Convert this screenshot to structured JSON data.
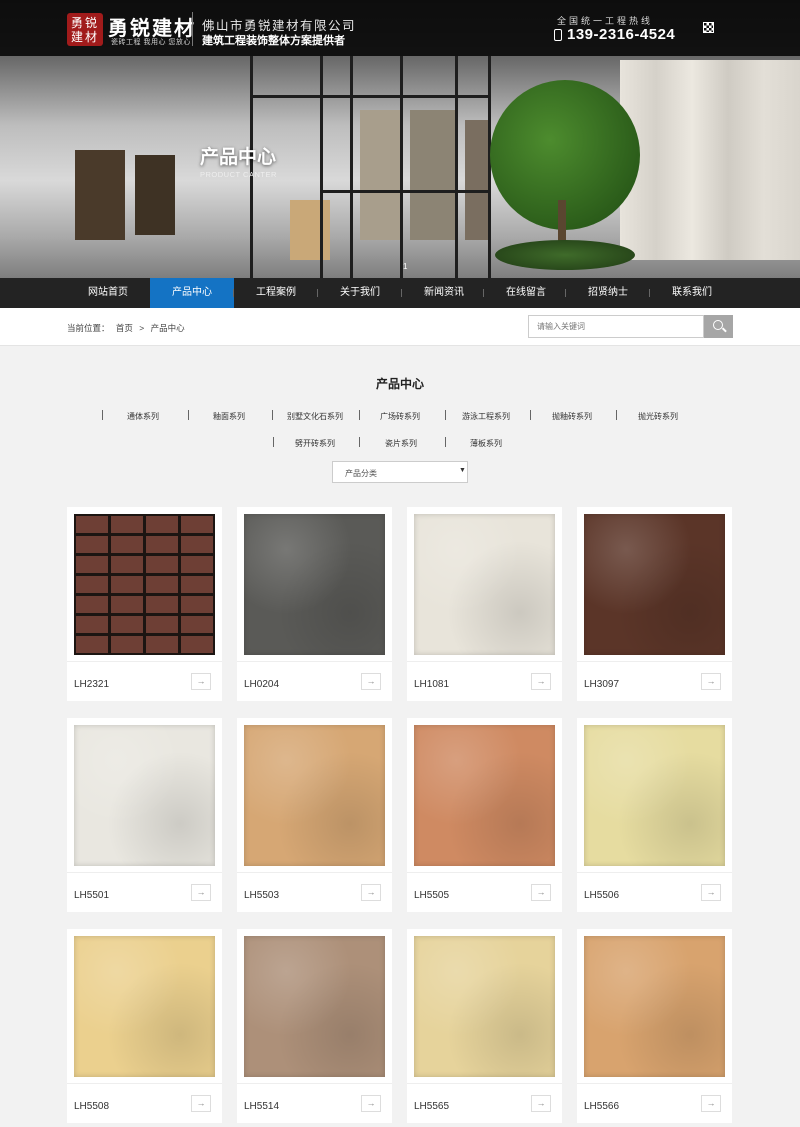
{
  "header": {
    "logo_seal": "勇锐建材",
    "logo_name": "勇锐建材",
    "logo_slogan": "瓷砖工程 我用心 您放心",
    "company_name": "佛山市勇锐建材有限公司",
    "tagline": "建筑工程装饰整体方案提供者",
    "hotline_label": "全国统一工程热线",
    "hotline_number": "139-2316-4524"
  },
  "banner": {
    "title": "产品中心",
    "subtitle": "PRODUCT CANTER",
    "slide_number": "1"
  },
  "nav": {
    "items": [
      "网站首页",
      "产品中心",
      "工程案例",
      "关于我们",
      "新闻资讯",
      "在线留言",
      "招贤纳士",
      "联系我们"
    ],
    "active_index": 1
  },
  "breadcrumb": {
    "label": "当前位置：",
    "home": "首页",
    "separator": ">",
    "current": "产品中心"
  },
  "search": {
    "placeholder": "请输入关键词"
  },
  "products": {
    "title": "产品中心",
    "categories_row1": [
      "通体系列",
      "釉面系列",
      "别墅文化石系列",
      "广场砖系列",
      "游泳工程系列",
      "抛釉砖系列",
      "抛光砖系列"
    ],
    "categories_row2": [
      "劈开砖系列",
      "瓷片系列",
      "薄板系列"
    ],
    "filter_label": "产品分类",
    "arrow_glyph": "→",
    "items": [
      {
        "code": "LH2321",
        "color": "#6e3f35",
        "pattern": "brick"
      },
      {
        "code": "LH0204",
        "color": "#5a5a57",
        "pattern": "stone"
      },
      {
        "code": "LH1081",
        "color": "#e8e4da",
        "pattern": "stone"
      },
      {
        "code": "LH3097",
        "color": "#5b3528",
        "pattern": "stone"
      },
      {
        "code": "LH5501",
        "color": "#e9e7e0",
        "pattern": "stone"
      },
      {
        "code": "LH5503",
        "color": "#d6a774",
        "pattern": "stone"
      },
      {
        "code": "LH5505",
        "color": "#cf8a62",
        "pattern": "stone"
      },
      {
        "code": "LH5506",
        "color": "#e6dca0",
        "pattern": "stone"
      },
      {
        "code": "LH5508",
        "color": "#ebd08e",
        "pattern": "stone"
      },
      {
        "code": "LH5514",
        "color": "#ad9079",
        "pattern": "stone"
      },
      {
        "code": "LH5565",
        "color": "#e6d39b",
        "pattern": "stone"
      },
      {
        "code": "LH5566",
        "color": "#d8a36e",
        "pattern": "stone"
      }
    ]
  },
  "colors": {
    "nav_active": "#1473c4",
    "nav_bg": "#232323"
  }
}
